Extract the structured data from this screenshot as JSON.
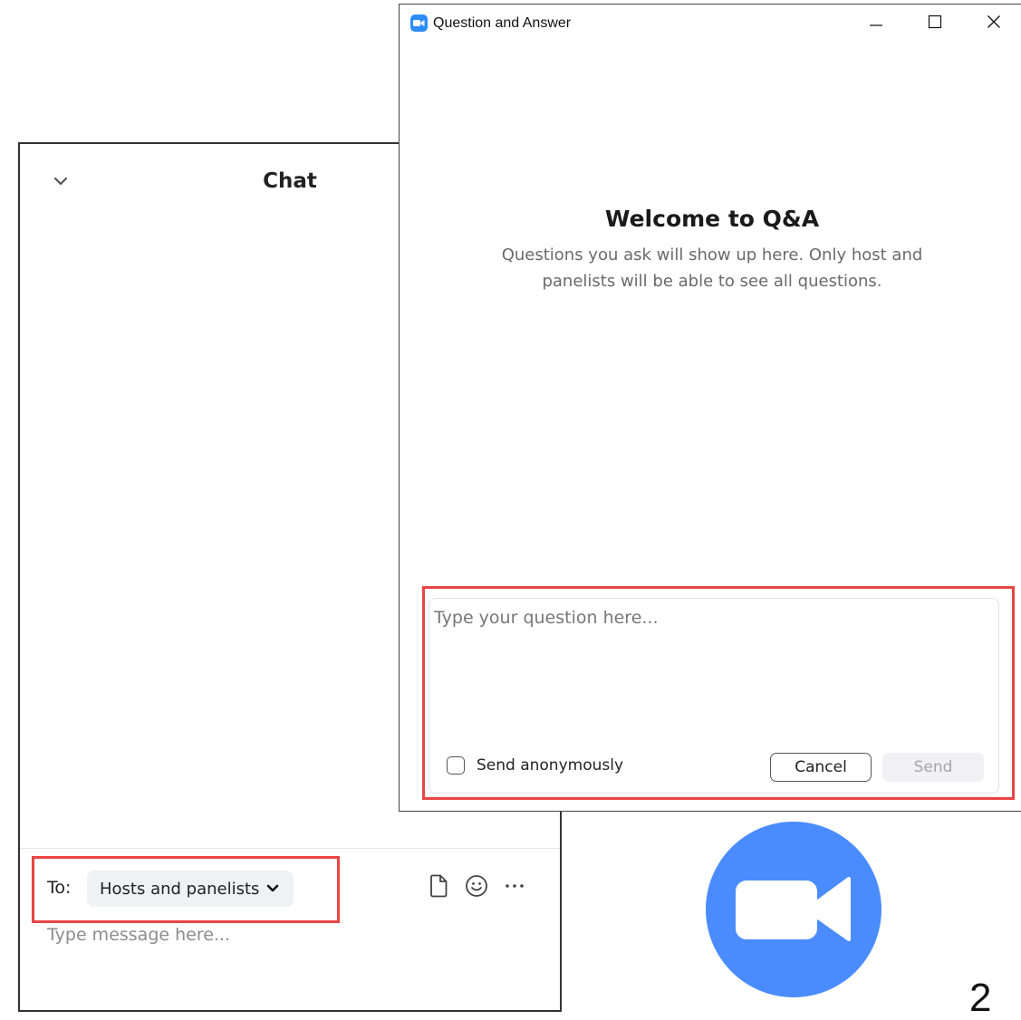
{
  "chat": {
    "title": "Chat",
    "to_label": "To:",
    "recipient": "Hosts and panelists",
    "message_placeholder": "Type message here...",
    "icons": [
      "chevron-down-icon",
      "file-icon",
      "emoji-icon",
      "more-icon"
    ]
  },
  "qa": {
    "window_title": "Question and Answer",
    "welcome_title": "Welcome to Q&A",
    "welcome_description": "Questions you ask will show up here. Only host and panelists will be able to see all questions.",
    "question_placeholder": "Type your question here...",
    "anonymous_label": "Send anonymously",
    "anonymous_checked": false,
    "cancel_label": "Cancel",
    "send_label": "Send",
    "send_enabled": false
  },
  "step_number": "2",
  "colors": {
    "zoom_blue": "#4a8cff",
    "highlight_red": "#e84545"
  }
}
